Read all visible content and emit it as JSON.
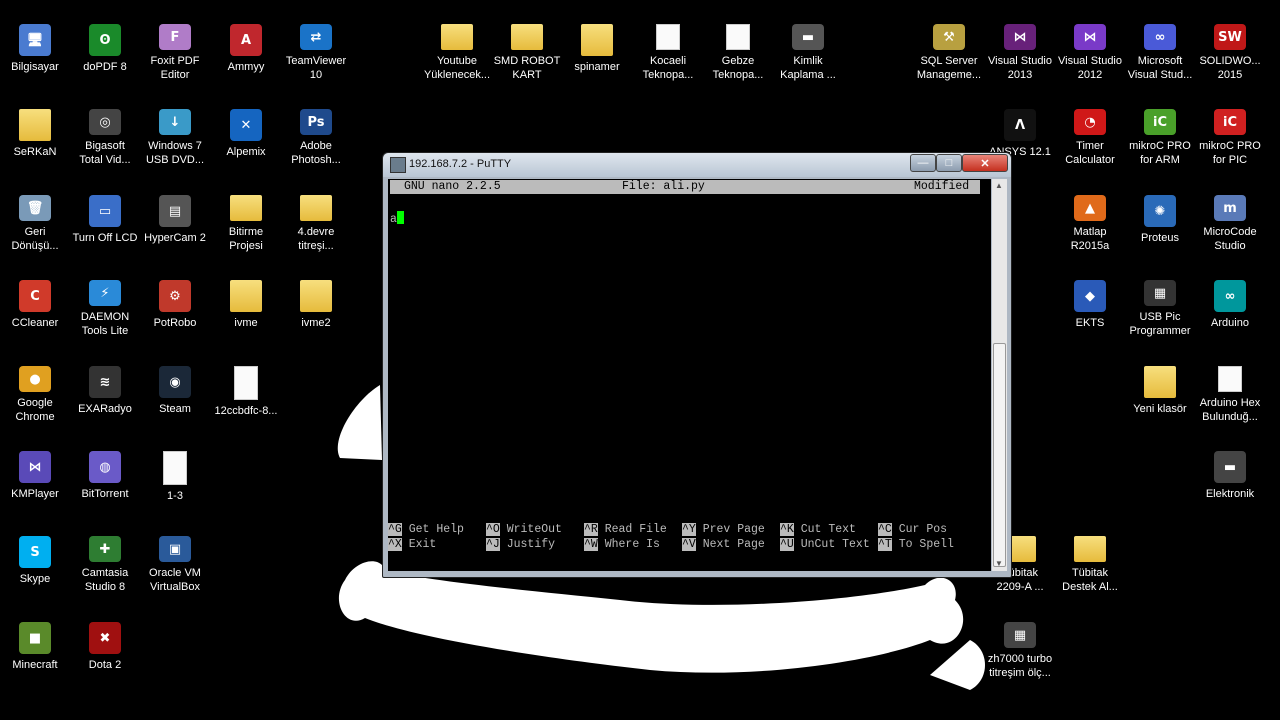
{
  "desktop_icons": [
    {
      "label": "Bilgisayar",
      "icon": "computer-icon",
      "glyph": "🖥",
      "color": "#4a7bd0"
    },
    {
      "label": "doPDF 8",
      "icon": "dopdf-icon",
      "glyph": "ʘ",
      "color": "#1a8a2a"
    },
    {
      "label": "Foxit PDF\nEditor",
      "icon": "foxit-icon",
      "glyph": "F",
      "color": "#b07cc8"
    },
    {
      "label": "Ammyy",
      "icon": "ammyy-icon",
      "glyph": "A",
      "color": "#c0272d"
    },
    {
      "label": "TeamViewer\n10",
      "icon": "teamviewer-icon",
      "glyph": "⇄",
      "color": "#1a73c8"
    },
    {
      "label": "SeRKaN",
      "icon": "user-folder-icon",
      "glyph": "",
      "color": "folder"
    },
    {
      "label": "Bigasoft\nTotal Vid...",
      "icon": "bigasoft-icon",
      "glyph": "◎",
      "color": "#444"
    },
    {
      "label": "Windows 7\nUSB DVD...",
      "icon": "usb-dvd-icon",
      "glyph": "↓",
      "color": "#3a9ac8"
    },
    {
      "label": "Alpemix",
      "icon": "alpemix-icon",
      "glyph": "✕",
      "color": "#1565c0"
    },
    {
      "label": "Adobe\nPhotosh...",
      "icon": "photoshop-icon",
      "glyph": "Ps",
      "color": "#1f4a8c"
    },
    {
      "label": "Geri\nDönüşü...",
      "icon": "recycle-bin-icon",
      "glyph": "🗑",
      "color": "#7a9ab8"
    },
    {
      "label": "Turn Off LCD",
      "icon": "laptop-icon",
      "glyph": "▭",
      "color": "#3a6ec8"
    },
    {
      "label": "HyperCam 2",
      "icon": "hypercam-icon",
      "glyph": "▤",
      "color": "#555"
    },
    {
      "label": "Bitirme\nProjesi",
      "icon": "folder-icon",
      "glyph": "",
      "color": "folder"
    },
    {
      "label": "4.devre\ntitreşi...",
      "icon": "folder-icon",
      "glyph": "",
      "color": "folder"
    },
    {
      "label": "CCleaner",
      "icon": "ccleaner-icon",
      "glyph": "C",
      "color": "#d03a2a"
    },
    {
      "label": "DAEMON\nTools Lite",
      "icon": "daemon-tools-icon",
      "glyph": "⚡",
      "color": "#2a8ad8"
    },
    {
      "label": "PotRobo",
      "icon": "potrobo-icon",
      "glyph": "⚙",
      "color": "#c0392b"
    },
    {
      "label": "ivme",
      "icon": "folder-icon",
      "glyph": "",
      "color": "folder"
    },
    {
      "label": "ivme2",
      "icon": "folder-icon",
      "glyph": "",
      "color": "folder"
    },
    {
      "label": "Google\nChrome",
      "icon": "chrome-icon",
      "glyph": "●",
      "color": "#e0a020"
    },
    {
      "label": "EXARadyo",
      "icon": "radio-icon",
      "glyph": "≋",
      "color": "#333"
    },
    {
      "label": "Steam",
      "icon": "steam-icon",
      "glyph": "◉",
      "color": "#1b2838"
    },
    {
      "label": "12ccbdfc-8...",
      "icon": "file-icon",
      "glyph": "",
      "color": "file"
    },
    {
      "label": "KMPlayer",
      "icon": "kmplayer-icon",
      "glyph": "⋈",
      "color": "#5a4ab8"
    },
    {
      "label": "BitTorrent",
      "icon": "bittorrent-icon",
      "glyph": "◍",
      "color": "#6a5ac8"
    },
    {
      "label": "1-3",
      "icon": "image-file-icon",
      "glyph": "",
      "color": "file"
    },
    {
      "label": "Skype",
      "icon": "skype-icon",
      "glyph": "S",
      "color": "#00aff0"
    },
    {
      "label": "Camtasia\nStudio 8",
      "icon": "camtasia-icon",
      "glyph": "✚",
      "color": "#2e7d32"
    },
    {
      "label": "Oracle VM\nVirtualBox",
      "icon": "virtualbox-icon",
      "glyph": "▣",
      "color": "#2a5a9a"
    },
    {
      "label": "Minecraft",
      "icon": "minecraft-icon",
      "glyph": "■",
      "color": "#5a8a2a"
    },
    {
      "label": "Dota 2",
      "icon": "dota2-icon",
      "glyph": "✖",
      "color": "#a01010"
    },
    {
      "label": "Youtube\nYüklenecek...",
      "icon": "folder-icon",
      "glyph": "",
      "color": "folder"
    },
    {
      "label": "SMD ROBOT\nKART",
      "icon": "folder-icon",
      "glyph": "",
      "color": "folder"
    },
    {
      "label": "spinamer",
      "icon": "folder-icon",
      "glyph": "",
      "color": "folder"
    },
    {
      "label": "Kocaeli\nTeknopa...",
      "icon": "document-icon",
      "glyph": "",
      "color": "file"
    },
    {
      "label": "Gebze\nTeknopa...",
      "icon": "document-icon",
      "glyph": "",
      "color": "file"
    },
    {
      "label": "Kimlik\nKaplama ...",
      "icon": "image-file-icon",
      "glyph": "▬",
      "color": "#555"
    },
    {
      "label": "SQL Server\nManageme...",
      "icon": "sql-server-icon",
      "glyph": "⚒",
      "color": "#b8a040"
    },
    {
      "label": "Visual Studio\n2013",
      "icon": "visual-studio-icon",
      "glyph": "⋈",
      "color": "#68217a"
    },
    {
      "label": "Visual Studio\n2012",
      "icon": "visual-studio-icon",
      "glyph": "⋈",
      "color": "#7a3ac8"
    },
    {
      "label": "Microsoft\nVisual Stud...",
      "icon": "visual-studio-icon",
      "glyph": "∞",
      "color": "#4a5ad8"
    },
    {
      "label": "SOLIDWO...\n2015",
      "icon": "solidworks-icon",
      "glyph": "SW",
      "color": "#c01818"
    },
    {
      "label": "ANSYS 12.1",
      "icon": "ansys-icon",
      "glyph": "Λ",
      "color": "#111"
    },
    {
      "label": "Timer\nCalculator",
      "icon": "timer-icon",
      "glyph": "◔",
      "color": "#d01818"
    },
    {
      "label": "mikroC PRO\nfor ARM",
      "icon": "mikroc-arm-icon",
      "glyph": "iC",
      "color": "#4aa02a"
    },
    {
      "label": "mikroC PRO\nfor PIC",
      "icon": "mikroc-pic-icon",
      "glyph": "iC",
      "color": "#d02020"
    },
    {
      "label": "Matlap\nR2015a",
      "icon": "matlab-icon",
      "glyph": "▲",
      "color": "#e06a1a"
    },
    {
      "label": "Proteus",
      "icon": "proteus-icon",
      "glyph": "✺",
      "color": "#2a6ab8"
    },
    {
      "label": "MicroCode\nStudio",
      "icon": "microcode-icon",
      "glyph": "m",
      "color": "#5a7ab8"
    },
    {
      "label": "EKTS",
      "icon": "ekts-icon",
      "glyph": "◆",
      "color": "#2a5ab8"
    },
    {
      "label": "USB Pic\nProgrammer",
      "icon": "chip-icon",
      "glyph": "▦",
      "color": "#333"
    },
    {
      "label": "Arduino",
      "icon": "arduino-icon",
      "glyph": "∞",
      "color": "#00979c"
    },
    {
      "label": "Yeni klasör",
      "icon": "folder-icon",
      "glyph": "",
      "color": "folder"
    },
    {
      "label": "Arduino Hex\nBulunduğ...",
      "icon": "document-icon",
      "glyph": "",
      "color": "file"
    },
    {
      "label": "Elektronik",
      "icon": "chip-icon",
      "glyph": "▬",
      "color": "#444"
    },
    {
      "label": "Tübitak\n2209-A ...",
      "icon": "folder-icon",
      "glyph": "",
      "color": "folder"
    },
    {
      "label": "Tübitak\nDestek Al...",
      "icon": "folder-icon",
      "glyph": "",
      "color": "folder"
    },
    {
      "label": "zh7000 turbo\ntitreşim ölç...",
      "icon": "chip-icon",
      "glyph": "▦",
      "color": "#444"
    }
  ],
  "window": {
    "title": "192.168.7.2 - PuTTY",
    "minimize": "—",
    "maximize": "□",
    "close": "✕"
  },
  "nano": {
    "version": "GNU nano 2.2.5",
    "file": "File: ali.py",
    "status": "Modified",
    "buffer": "a",
    "shortcuts_row1": [
      {
        "key": "^G",
        "label": " Get Help"
      },
      {
        "key": "^O",
        "label": " WriteOut"
      },
      {
        "key": "^R",
        "label": " Read File"
      },
      {
        "key": "^Y",
        "label": " Prev Page"
      },
      {
        "key": "^K",
        "label": " Cut Text"
      },
      {
        "key": "^C",
        "label": " Cur Pos"
      }
    ],
    "shortcuts_row2": [
      {
        "key": "^X",
        "label": " Exit"
      },
      {
        "key": "^J",
        "label": " Justify"
      },
      {
        "key": "^W",
        "label": " Where Is"
      },
      {
        "key": "^V",
        "label": " Next Page"
      },
      {
        "key": "^U",
        "label": " UnCut Text"
      },
      {
        "key": "^T",
        "label": " To Spell"
      }
    ]
  }
}
